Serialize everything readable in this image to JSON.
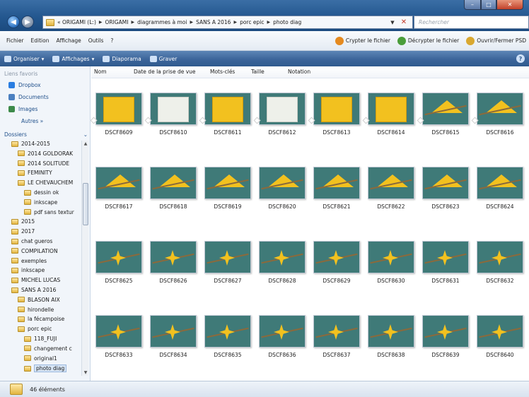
{
  "window": {
    "address_crumbs": [
      "« ORIGAMI (L:)",
      "ORIGAMI",
      "diagrammes à moi",
      "SANS A 2016",
      "porc epic",
      "photo diag"
    ],
    "search_placeholder": "Rechercher"
  },
  "menubar": {
    "items": [
      "Fichier",
      "Edition",
      "Affichage",
      "Outils",
      "?"
    ],
    "right_items": [
      {
        "label": "Crypter le fichier",
        "icon": "lock-icon",
        "color": "#e58a1f"
      },
      {
        "label": "Décrypter le fichier",
        "icon": "unlock-icon",
        "color": "#4a9d3a"
      },
      {
        "label": "Ouvrir/Fermer PSD",
        "icon": "folder-open-icon",
        "color": "#d9a830"
      }
    ]
  },
  "toolbar": {
    "items": [
      {
        "label": "Organiser",
        "icon": "organize-icon",
        "has_dropdown": true
      },
      {
        "label": "Affichages",
        "icon": "views-icon",
        "has_dropdown": true
      },
      {
        "label": "Diaporama",
        "icon": "slideshow-icon",
        "has_dropdown": false
      },
      {
        "label": "Graver",
        "icon": "burn-icon",
        "has_dropdown": false
      }
    ]
  },
  "navpane": {
    "favorites_header": "Liens favoris",
    "favorites": [
      {
        "label": "Dropbox",
        "color": "#2a7de1"
      },
      {
        "label": "Documents",
        "color": "#4a7fc0"
      },
      {
        "label": "Images",
        "color": "#3c8a4a"
      }
    ],
    "more": "Autres »",
    "folders_header": "Dossiers",
    "tree": [
      {
        "label": "2014-2015",
        "indent": 1
      },
      {
        "label": "2014 GOLDORAK",
        "indent": 2
      },
      {
        "label": "2014 SOLITUDE",
        "indent": 2
      },
      {
        "label": "FEMINITY",
        "indent": 2
      },
      {
        "label": "LE CHEVAUCHEM",
        "indent": 2
      },
      {
        "label": "dessin ok",
        "indent": 3
      },
      {
        "label": "inkscape",
        "indent": 3
      },
      {
        "label": "pdf sans textur",
        "indent": 3
      },
      {
        "label": "2015",
        "indent": 1
      },
      {
        "label": "2017",
        "indent": 1
      },
      {
        "label": "chat gueros",
        "indent": 1
      },
      {
        "label": "COMPILATION",
        "indent": 1
      },
      {
        "label": "exemples",
        "indent": 1
      },
      {
        "label": "inkscape",
        "indent": 1
      },
      {
        "label": "MICHEL LUCAS",
        "indent": 1
      },
      {
        "label": "SANS A 2016",
        "indent": 1
      },
      {
        "label": "BLASON AIX",
        "indent": 2
      },
      {
        "label": "hirondelle",
        "indent": 2
      },
      {
        "label": "la fécampoise",
        "indent": 2
      },
      {
        "label": "porc epic",
        "indent": 2
      },
      {
        "label": "118_FUJI",
        "indent": 3
      },
      {
        "label": "changement c",
        "indent": 3
      },
      {
        "label": "original1",
        "indent": 3
      },
      {
        "label": "photo diag",
        "indent": 3,
        "selected": true
      }
    ]
  },
  "content": {
    "columns": [
      "Nom",
      "Date de la prise de vue",
      "Mots-clés",
      "Taille",
      "Notation"
    ],
    "files": [
      {
        "name": "DSCF8609",
        "style": "yellow"
      },
      {
        "name": "DSCF8610",
        "style": "white"
      },
      {
        "name": "DSCF8611",
        "style": "yellow"
      },
      {
        "name": "DSCF8612",
        "style": "white"
      },
      {
        "name": "DSCF8613",
        "style": "yellow"
      },
      {
        "name": "DSCF8614",
        "style": "yellow"
      },
      {
        "name": "DSCF8615",
        "style": "triangle"
      },
      {
        "name": "DSCF8616",
        "style": "triangle"
      },
      {
        "name": "DSCF8617",
        "style": "triangle"
      },
      {
        "name": "DSCF8618",
        "style": "triangle"
      },
      {
        "name": "DSCF8619",
        "style": "triangle"
      },
      {
        "name": "DSCF8620",
        "style": "triangle"
      },
      {
        "name": "DSCF8621",
        "style": "triangle"
      },
      {
        "name": "DSCF8622",
        "style": "triangle"
      },
      {
        "name": "DSCF8623",
        "style": "triangle"
      },
      {
        "name": "DSCF8624",
        "style": "triangle"
      },
      {
        "name": "DSCF8625",
        "style": "star"
      },
      {
        "name": "DSCF8626",
        "style": "star"
      },
      {
        "name": "DSCF8627",
        "style": "star"
      },
      {
        "name": "DSCF8628",
        "style": "star"
      },
      {
        "name": "DSCF8629",
        "style": "star"
      },
      {
        "name": "DSCF8630",
        "style": "star"
      },
      {
        "name": "DSCF8631",
        "style": "star"
      },
      {
        "name": "DSCF8632",
        "style": "star"
      },
      {
        "name": "DSCF8633",
        "style": "star"
      },
      {
        "name": "DSCF8634",
        "style": "star"
      },
      {
        "name": "DSCF8635",
        "style": "star"
      },
      {
        "name": "DSCF8636",
        "style": "star"
      },
      {
        "name": "DSCF8637",
        "style": "star"
      },
      {
        "name": "DSCF8638",
        "style": "star"
      },
      {
        "name": "DSCF8639",
        "style": "star"
      },
      {
        "name": "DSCF8640",
        "style": "star"
      }
    ]
  },
  "status": {
    "count_label": "46 éléments"
  }
}
